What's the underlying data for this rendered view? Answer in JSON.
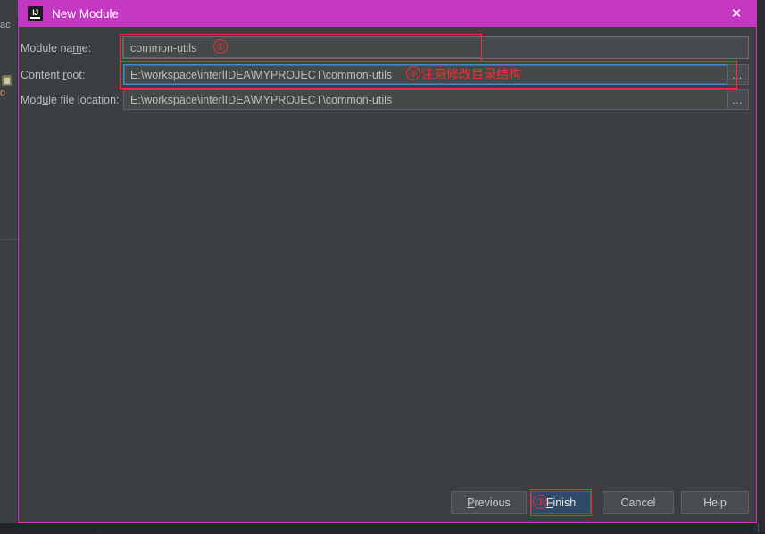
{
  "background": {
    "toolbar_fragment": "ac",
    "tree_fragment": "o",
    "dots": "· ·"
  },
  "dialog": {
    "title": "New Module",
    "logo_text": "IJ",
    "close_icon": "✕",
    "accent_color": "#c337c3"
  },
  "form": {
    "rows": [
      {
        "label_pre": "Module na",
        "label_mn": "m",
        "label_post": "e:",
        "value": "common-utils",
        "browse": ""
      },
      {
        "label_pre": "Content ",
        "label_mn": "r",
        "label_post": "oot:",
        "value": "E:\\workspace\\interlIDEA\\MYPROJECT\\common-utils",
        "browse": "…"
      },
      {
        "label_pre": "Mod",
        "label_mn": "u",
        "label_post": "le file location:",
        "value": "E:\\workspace\\interlIDEA\\MYPROJECT\\common-utils",
        "browse": "…"
      }
    ]
  },
  "annotations": {
    "marker1": "①",
    "marker2": "②",
    "marker3": "③",
    "note2": "注意修改目录结构",
    "color": "#ff2a2a"
  },
  "buttons": {
    "previous": {
      "pre": "",
      "mn": "P",
      "post": "revious"
    },
    "finish": {
      "pre": "",
      "mn": "F",
      "post": "inish"
    },
    "cancel": {
      "pre": "Cancel",
      "mn": "",
      "post": ""
    },
    "help": {
      "pre": "Help",
      "mn": "",
      "post": ""
    }
  }
}
